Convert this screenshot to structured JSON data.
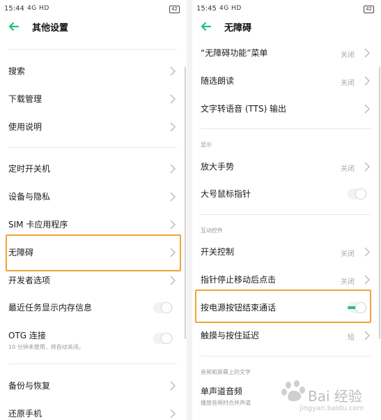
{
  "left": {
    "status": {
      "time": "15:44",
      "signal": "4G HD",
      "battery": "42"
    },
    "title": "其他设置",
    "items": [
      {
        "label": "搜索"
      },
      {
        "label": "下载管理"
      },
      {
        "label": "使用说明"
      },
      {
        "label": "定时开关机"
      },
      {
        "label": "设备与隐私"
      },
      {
        "label": "SIM 卡应用程序"
      },
      {
        "label": "无障碍"
      },
      {
        "label": "开发者选项"
      },
      {
        "label": "最近任务显示内存信息",
        "toggle": false
      },
      {
        "label": "OTG 连接",
        "sub": "10 分钟未使用，将自动关闭。",
        "toggle": false
      },
      {
        "label": "备份与恢复"
      },
      {
        "label": "还原手机"
      }
    ]
  },
  "right": {
    "status": {
      "time": "15:45",
      "signal": "4G HD",
      "battery": "42"
    },
    "title": "无障碍",
    "items": [
      {
        "label": "“无障碍功能”菜单",
        "value": "关闭"
      },
      {
        "label": "随选朗读",
        "value": "关闭"
      },
      {
        "label": "文字转语音 (TTS) 输出"
      },
      {
        "label": "放大手势",
        "value": "关闭"
      },
      {
        "label": "大号鼠标指针",
        "toggle": false
      },
      {
        "label": "开关控制",
        "value": "关闭"
      },
      {
        "label": "指针停止移动后点击",
        "value": "关闭"
      },
      {
        "label": "按电源按钮结束通话",
        "toggle": true
      },
      {
        "label": "触摸与按住延迟",
        "value": "短"
      },
      {
        "label": "单声道音频",
        "sub": "播放音频时合并声道"
      }
    ],
    "sections": {
      "display": "显示",
      "interaction": "互动控件",
      "audio": "音频和屏幕上的文字"
    }
  },
  "watermark": {
    "text": "Bai 经验",
    "url": "jingyan.baidu.com"
  },
  "colors": {
    "accent": "#1fc27a",
    "highlight": "#f0a236"
  }
}
